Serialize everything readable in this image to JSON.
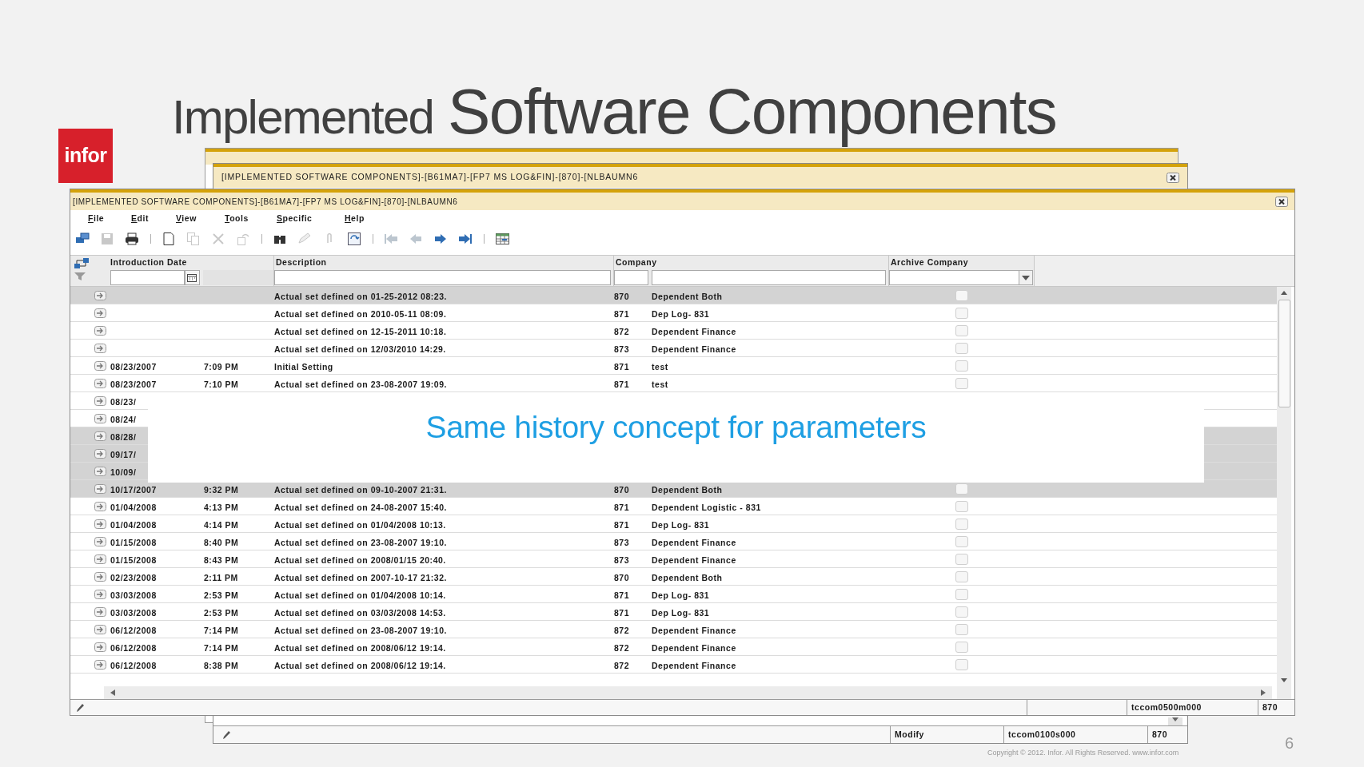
{
  "slide": {
    "logo": "infor",
    "title_prefix": "Implemented",
    "title_main": "Software Components",
    "caption": "Same history concept for parameters",
    "copyright": "Copyright © 2012. Infor. All Rights Reserved. www.infor.com",
    "page_number": "6"
  },
  "back_window": {
    "title": "[IMPLEMENTED SOFTWARE COMPONENTS]-[B61MA7]-[FP7 MS LOG&FIN]-[870]-[NLBAUMN6",
    "status_bar": [
      "Modify",
      "tccom0100s000",
      "870"
    ]
  },
  "window": {
    "title": "[IMPLEMENTED SOFTWARE COMPONENTS]-[B61MA7]-[FP7 MS LOG&FIN]-[870]-[NLBAUMN6",
    "menu": [
      "File",
      "Edit",
      "View",
      "Tools",
      "Specific",
      "Help"
    ],
    "toolbar": [
      {
        "kind": "session",
        "disabled": false
      },
      {
        "kind": "save",
        "disabled": true
      },
      {
        "kind": "print",
        "disabled": false
      },
      {
        "kind": "separator"
      },
      {
        "kind": "new",
        "disabled": false
      },
      {
        "kind": "copy",
        "disabled": true
      },
      {
        "kind": "delete",
        "disabled": true
      },
      {
        "kind": "undo",
        "disabled": true
      },
      {
        "kind": "separator"
      },
      {
        "kind": "find",
        "disabled": false
      },
      {
        "kind": "edit",
        "disabled": true
      },
      {
        "kind": "attach",
        "disabled": true
      },
      {
        "kind": "refresh",
        "disabled": false
      },
      {
        "kind": "separator"
      },
      {
        "kind": "first",
        "disabled": true
      },
      {
        "kind": "prev",
        "disabled": true
      },
      {
        "kind": "next",
        "disabled": false
      },
      {
        "kind": "last",
        "disabled": false
      },
      {
        "kind": "separator"
      },
      {
        "kind": "table",
        "disabled": false
      }
    ],
    "columns": [
      "Introduction Date",
      "Description",
      "Company",
      "Archive Company"
    ],
    "rows": [
      {
        "kind": "full",
        "selected": true,
        "description": "Actual set defined on 01-25-2012 08:23.",
        "company": "870",
        "company_name": "Dependent Both",
        "archive": false
      },
      {
        "kind": "full",
        "selected": false,
        "description": "Actual set defined on 2010-05-11 08:09.",
        "company": "871",
        "company_name": "Dep Log- 831",
        "archive": false
      },
      {
        "kind": "full",
        "selected": false,
        "description": "Actual set defined on 12-15-2011 10:18.",
        "company": "872",
        "company_name": "Dependent Finance",
        "archive": false
      },
      {
        "kind": "full",
        "selected": false,
        "description": "Actual set defined on 12/03/2010 14:29.",
        "company": "873",
        "company_name": "Dependent Finance",
        "archive": false
      },
      {
        "kind": "full",
        "selected": false,
        "date": "08/23/2007",
        "time": "7:09 PM",
        "description": "Initial Setting",
        "company": "871",
        "company_name": "test",
        "archive": false
      },
      {
        "kind": "full",
        "selected": false,
        "date": "08/23/2007",
        "time": "7:10 PM",
        "description": "Actual set defined on 23-08-2007 19:09.",
        "company": "871",
        "company_name": "test",
        "archive": false
      },
      {
        "kind": "partial",
        "selected": false,
        "date": "08/23/"
      },
      {
        "kind": "partial",
        "selected": false,
        "date": "08/24/"
      },
      {
        "kind": "partial",
        "selected": true,
        "date": "08/28/"
      },
      {
        "kind": "partial",
        "selected": true,
        "date": "09/17/"
      },
      {
        "kind": "partial",
        "selected": true,
        "date": "10/09/"
      },
      {
        "kind": "full",
        "selected": true,
        "date": "10/17/2007",
        "time": "9:32 PM",
        "description": "Actual set defined on 09-10-2007 21:31.",
        "company": "870",
        "company_name": "Dependent Both",
        "archive": false
      },
      {
        "kind": "full",
        "selected": false,
        "date": "01/04/2008",
        "time": "4:13 PM",
        "description": "Actual set defined on 24-08-2007 15:40.",
        "company": "871",
        "company_name": "Dependent Logistic - 831",
        "archive": false
      },
      {
        "kind": "full",
        "selected": false,
        "date": "01/04/2008",
        "time": "4:14 PM",
        "description": "Actual set defined on 01/04/2008 10:13.",
        "company": "871",
        "company_name": "Dep Log- 831",
        "archive": false
      },
      {
        "kind": "full",
        "selected": false,
        "date": "01/15/2008",
        "time": "8:40 PM",
        "description": "Actual set defined on 23-08-2007 19:10.",
        "company": "873",
        "company_name": "Dependent Finance",
        "archive": false
      },
      {
        "kind": "full",
        "selected": false,
        "date": "01/15/2008",
        "time": "8:43 PM",
        "description": "Actual set defined on 2008/01/15 20:40.",
        "company": "873",
        "company_name": "Dependent Finance",
        "archive": false
      },
      {
        "kind": "full",
        "selected": false,
        "date": "02/23/2008",
        "time": "2:11 PM",
        "description": "Actual set defined on 2007-10-17 21:32.",
        "company": "870",
        "company_name": "Dependent Both",
        "archive": false
      },
      {
        "kind": "full",
        "selected": false,
        "date": "03/03/2008",
        "time": "2:53 PM",
        "description": "Actual set defined on 01/04/2008 10:14.",
        "company": "871",
        "company_name": "Dep Log- 831",
        "archive": false
      },
      {
        "kind": "full",
        "selected": false,
        "date": "03/03/2008",
        "time": "2:53 PM",
        "description": "Actual set defined on 03/03/2008 14:53.",
        "company": "871",
        "company_name": "Dep Log- 831",
        "archive": false
      },
      {
        "kind": "full",
        "selected": false,
        "date": "06/12/2008",
        "time": "7:14 PM",
        "description": "Actual set defined on 23-08-2007 19:10.",
        "company": "872",
        "company_name": "Dependent Finance",
        "archive": false
      },
      {
        "kind": "full",
        "selected": false,
        "date": "06/12/2008",
        "time": "7:14 PM",
        "description": "Actual set defined on 2008/06/12 19:14.",
        "company": "872",
        "company_name": "Dependent Finance",
        "archive": false
      },
      {
        "kind": "full",
        "selected": false,
        "date": "06/12/2008",
        "time": "8:38 PM",
        "description": "Actual set defined on 2008/06/12 19:14.",
        "company": "872",
        "company_name": "Dependent Finance",
        "archive": false
      }
    ],
    "status_bar": [
      "tccom0500m000",
      "870"
    ]
  }
}
